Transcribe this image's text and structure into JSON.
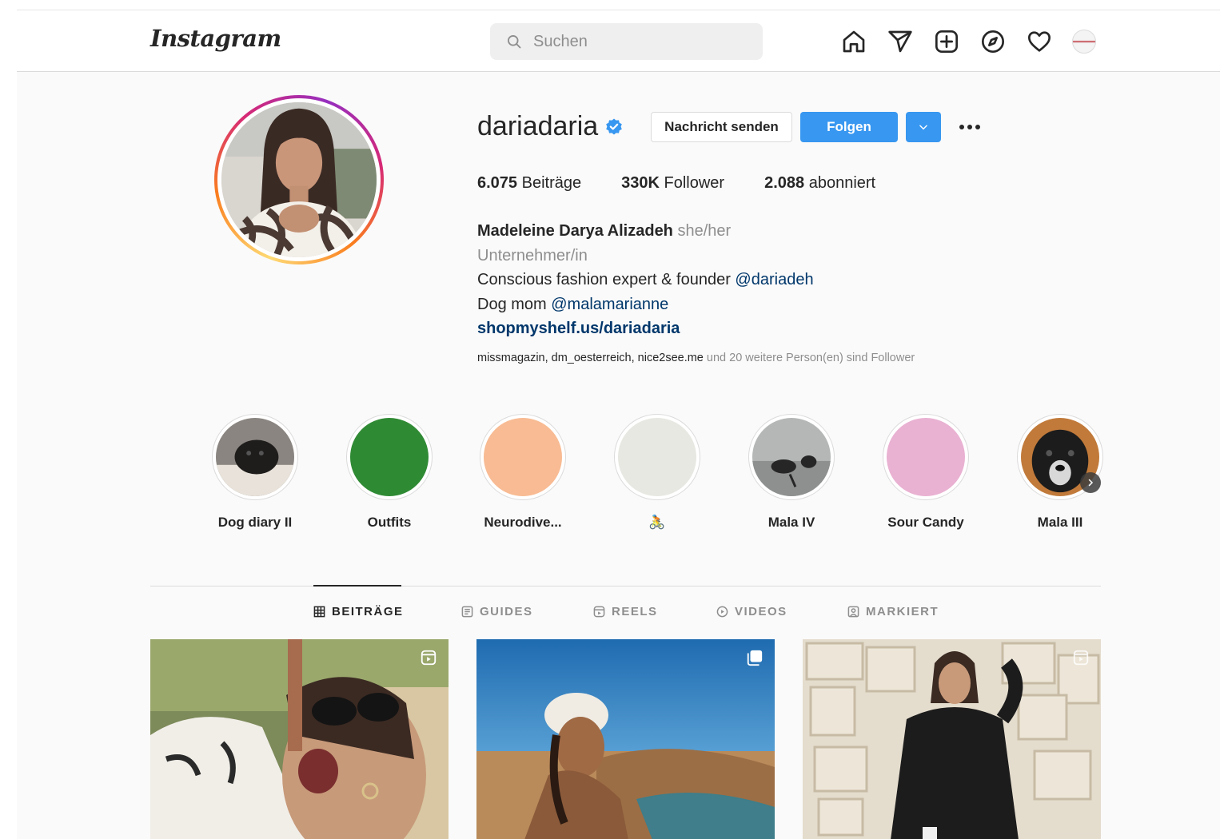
{
  "nav": {
    "logo": "Instagram",
    "search_placeholder": "Suchen"
  },
  "profile": {
    "username": "dariadaria",
    "message_button": "Nachricht senden",
    "follow_button": "Folgen",
    "stats": {
      "posts_count": "6.075",
      "posts_label": "Beiträge",
      "followers_count": "330K",
      "followers_label": "Follower",
      "following_count": "2.088",
      "following_label": "abonniert"
    },
    "bio": {
      "full_name": "Madeleine Darya Alizadeh",
      "pronouns": "she/her",
      "category": "Unternehmer/in",
      "line1_text": "Conscious fashion expert & founder ",
      "line1_mention": "@dariadeh",
      "line2_text": "Dog mom ",
      "line2_mention": "@malamarianne",
      "link": "shopmyshelf.us/dariadaria"
    },
    "followed_by": {
      "names": "missmagazin, dm_oesterreich, nice2see.me",
      "suffix": " und 20 weitere Person(en) sind Follower"
    }
  },
  "highlights": [
    {
      "label": "Dog diary II",
      "color": "#b9b4ad"
    },
    {
      "label": "Outfits",
      "color": "#2f8a34"
    },
    {
      "label": "Neurodive...",
      "color": "#f8bb93"
    },
    {
      "label": "🚴",
      "color": "#e6e8e1"
    },
    {
      "label": "Mala IV",
      "color": "#9b9c9c"
    },
    {
      "label": "Sour Candy",
      "color": "#e9b1d2"
    },
    {
      "label": "Mala III",
      "color": "#2a2a2a"
    }
  ],
  "tabs": [
    {
      "label": "BEITRÄGE",
      "active": true
    },
    {
      "label": "GUIDES",
      "active": false
    },
    {
      "label": "REELS",
      "active": false
    },
    {
      "label": "VIDEOS",
      "active": false
    },
    {
      "label": "MARKIERT",
      "active": false
    }
  ],
  "colors": {
    "accent_blue": "#3897f0",
    "link_blue": "#00376b",
    "muted_text": "#8e8e8e",
    "border": "#dbdbdb"
  }
}
